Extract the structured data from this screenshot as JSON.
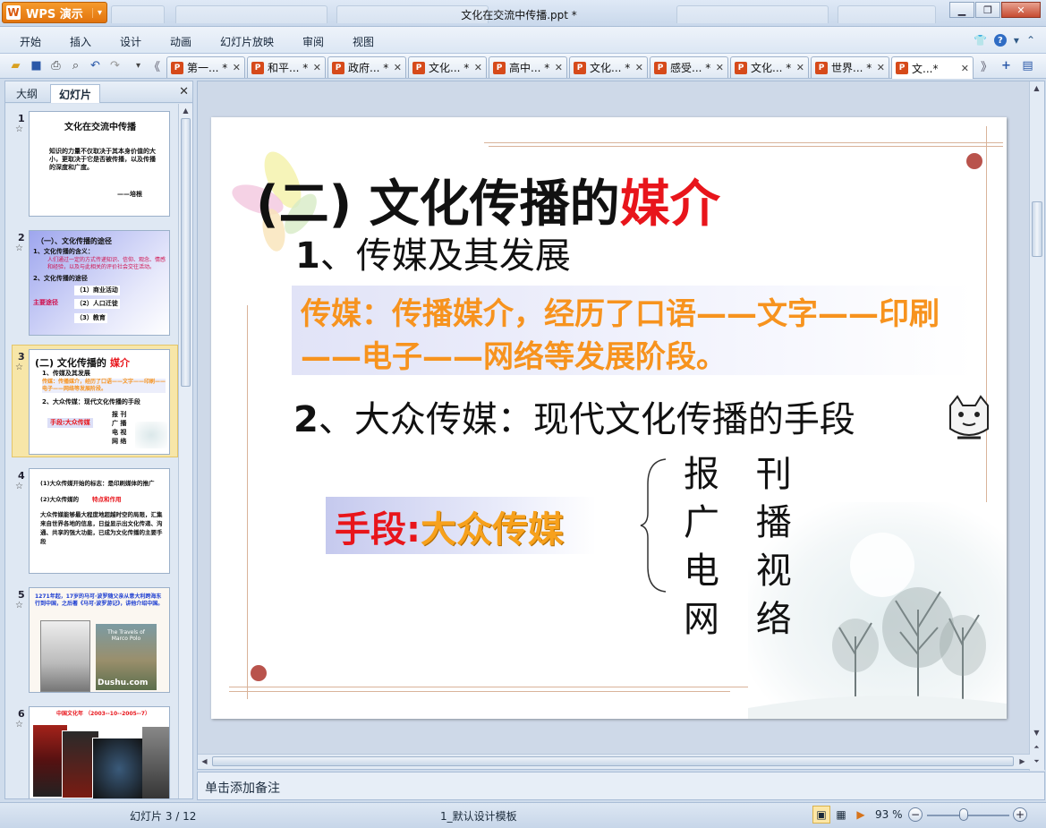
{
  "window": {
    "app_button": "WPS 演示",
    "title": "文化在交流中传播.ppt *"
  },
  "menu": {
    "items": [
      "开始",
      "插入",
      "设计",
      "动画",
      "幻灯片放映",
      "审阅",
      "视图"
    ]
  },
  "tabs": [
    {
      "label": "第一... *",
      "active": false
    },
    {
      "label": "和平... *",
      "active": false
    },
    {
      "label": "政府... *",
      "active": false
    },
    {
      "label": "文化... *",
      "active": false
    },
    {
      "label": "高中... *",
      "active": false
    },
    {
      "label": "文化... *",
      "active": false
    },
    {
      "label": "感受... *",
      "active": false
    },
    {
      "label": "文化... *",
      "active": false
    },
    {
      "label": "世界... *",
      "active": false
    },
    {
      "label": "文...*",
      "active": true
    }
  ],
  "panel": {
    "tab_outline": "大纲",
    "tab_slides": "幻灯片",
    "slides": [
      {
        "num": "1",
        "title": "文化在交流中传播",
        "body": "知识的力量不仅取决于其本身价值的大小，更取决于它是否被传播，以及传播的深度和广度。",
        "author": "——培根"
      },
      {
        "num": "2",
        "lines": [
          "（一）、文化传播的途径",
          "1、文化传播的含义：",
          "人们通过一定的方式传递知识、信仰、观念、情感和经验，以及与此相关的评价社会交往活动。",
          "2、文化传播的途径",
          "（1）商业活动",
          "主要途径",
          "（2）人口迁徙",
          "（3）教育"
        ]
      },
      {
        "num": "3",
        "lines": [
          "(二) 文化传播的",
          "媒介",
          "1、传媒及其发展",
          "传媒：传播媒介，经历了口语——文字——印刷——电子——网络等发展阶段。",
          "2、大众传媒：现代文化传播的手段",
          "手段:大众传媒",
          "报 刊",
          "广 播",
          "电 视",
          "网 络"
        ]
      },
      {
        "num": "4",
        "lines": [
          "(1)大众传媒开始的标志：是印刷媒体的推广",
          "(2)大众传媒的",
          "特点和作用",
          "大众传媒能够最大程度地超越时空的局限，汇集来自世界各地的信息，日益显示出文化传递、沟通、共享的强大功能，已成为文化传播的主要手段"
        ]
      },
      {
        "num": "5",
        "lines": [
          "1271年起，17岁的马可·波罗随父亲从意大利跨海东行到中国，之后著《马可·波罗游记》，讲他介绍中国。",
          "The Travels of Marco Polo",
          "Dushu.com"
        ]
      },
      {
        "num": "6",
        "lines": [
          "中国文化年 （2003--10--2005--7）"
        ]
      }
    ]
  },
  "slide": {
    "title_prefix": "(二) 文化传播的",
    "title_highlight": "媒介",
    "point1_num": "1",
    "point1_text": "、传媒及其发展",
    "box_text": "传媒：传播媒介，经历了口语——文字——印刷——电子——网络等发展阶段。",
    "point2_num": "2",
    "point2_text": "、大众传媒：现代文化传播的手段",
    "pill_prefix": "手段:",
    "pill_highlight": "大众传媒",
    "media_list": [
      "报 刊",
      "广 播",
      "电 视",
      "网 络"
    ]
  },
  "notes": {
    "placeholder": "单击添加备注"
  },
  "status": {
    "slide_counter": "幻灯片 3 / 12",
    "template": "1_默认设计模板",
    "zoom": "93 %",
    "zoom_level": 0.45
  }
}
